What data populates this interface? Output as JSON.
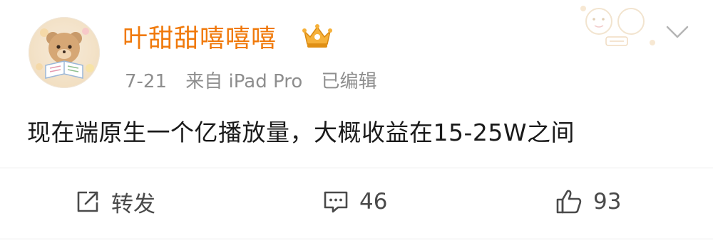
{
  "post": {
    "username": "叶甜甜嘻嘻嘻",
    "meta": {
      "date": "7-21",
      "source": "来自 iPad Pro",
      "edited": "已编辑"
    },
    "text": "现在端原生一个亿播放量，大概收益在15-25W之间"
  },
  "actions": {
    "repost_label": "转发",
    "comment_count": "46",
    "like_count": "93"
  },
  "icons": {
    "verified_badge": "vip-crown-icon",
    "menu": "chevron-down-icon",
    "repost": "repost-icon",
    "comment": "comment-icon",
    "like": "thumbs-up-icon"
  },
  "colors": {
    "username": "#f0790a",
    "meta": "#8e8e8e",
    "text": "#1a1a1a",
    "action": "#4a4a4a"
  }
}
